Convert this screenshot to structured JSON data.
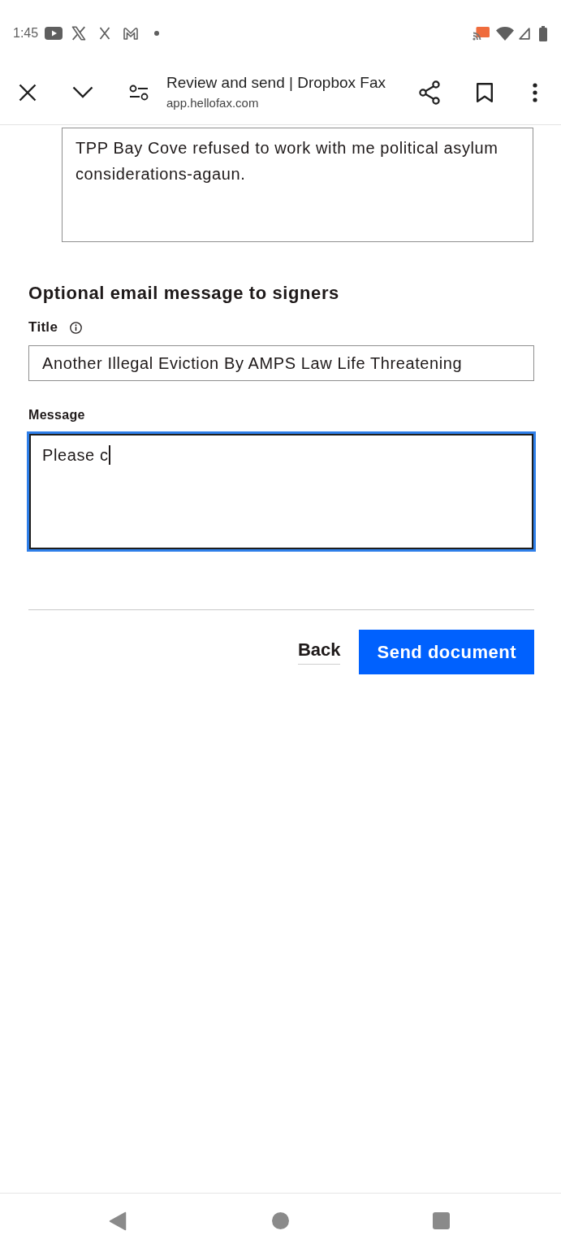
{
  "status_bar": {
    "time": "1:45"
  },
  "browser_toolbar": {
    "page_title": "Review and send | Dropbox Fax",
    "url": "app.hellofax.com"
  },
  "cover_note": {
    "value": "TPP Bay Cove refused to work with me political asylum considerations-agaun."
  },
  "email_message": {
    "heading": "Optional email message to signers",
    "title_label": "Title",
    "title_value": "Another Illegal Eviction By AMPS Law Life Threatening",
    "message_label": "Message",
    "message_value": "Please c",
    "message_focused": true
  },
  "actions": [
    {
      "label": "Back",
      "kind": "link"
    },
    {
      "label": "Send document",
      "kind": "primary"
    }
  ]
}
